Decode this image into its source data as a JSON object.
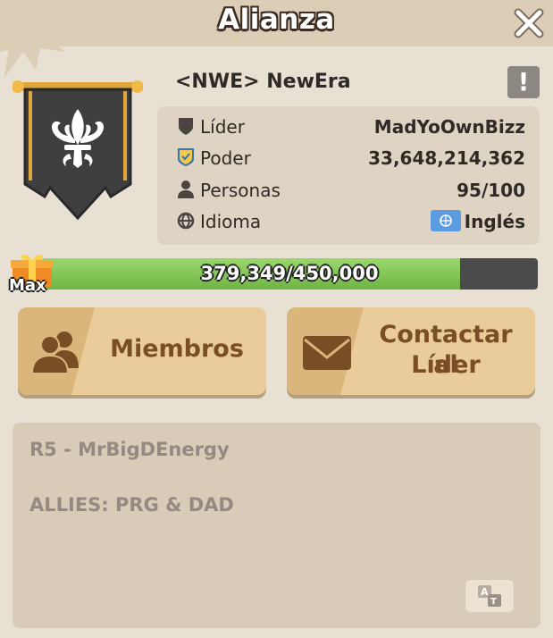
{
  "header": {
    "title": "Alianza"
  },
  "alliance": {
    "name": "<NWE> NewEra"
  },
  "info": {
    "leader_label": "Líder",
    "leader_value": "MadYoOwnBizz",
    "power_label": "Poder",
    "power_value": "33,648,214,362",
    "members_label": "Personas",
    "members_value": "95/100",
    "language_label": "Idioma",
    "language_value": "Inglés"
  },
  "progress": {
    "text": "379,349/450,000",
    "max_label": "Max",
    "current": 379349,
    "total": 450000
  },
  "buttons": {
    "members_label": "Miembros",
    "contact_line1": "Contactar al",
    "contact_line2": "Líder"
  },
  "note": {
    "line1": "R5 - MrBigDEnergy",
    "line2": "ALLIES: PRG & DAD"
  },
  "colors": {
    "header_bg": "#dccdb6",
    "panel_bg": "#e8e0d3",
    "progress_fill": "#7fc455",
    "button_bg": "#e9cc9a",
    "button_text": "#7a4e25"
  },
  "icons": {
    "close": "close-icon",
    "alert": "exclamation-icon",
    "leader": "shield-icon",
    "power": "badge-icon",
    "members": "person-icon",
    "language": "globe-icon",
    "members_button": "people-icon",
    "contact_button": "envelope-icon",
    "translate": "translate-icon",
    "gift": "gift-icon",
    "banner": "fleur-de-lis-banner"
  }
}
